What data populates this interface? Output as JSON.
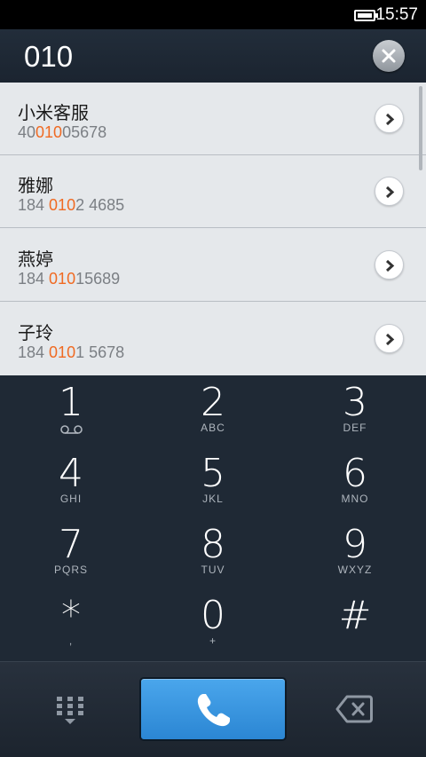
{
  "status_bar": {
    "time": "15:57"
  },
  "dialer": {
    "dialed_number": "010"
  },
  "results": [
    {
      "name": "小米客服",
      "number_pre": "40",
      "number_match": "010",
      "number_post": "05678"
    },
    {
      "name": "雅娜",
      "number_pre": "184 ",
      "number_match": "010",
      "number_post": "2 4685"
    },
    {
      "name": "燕婷",
      "number_pre": "184 ",
      "number_match": "010",
      "number_post": "15689"
    },
    {
      "name": "子玲",
      "number_pre": "184 ",
      "number_match": "010",
      "number_post": "1 5678"
    }
  ],
  "keypad": [
    {
      "digit": "1",
      "letters": "",
      "icon": "voicemail-icon"
    },
    {
      "digit": "2",
      "letters": "ABC"
    },
    {
      "digit": "3",
      "letters": "DEF"
    },
    {
      "digit": "4",
      "letters": "GHI"
    },
    {
      "digit": "5",
      "letters": "JKL"
    },
    {
      "digit": "6",
      "letters": "MNO"
    },
    {
      "digit": "7",
      "letters": "PQRS"
    },
    {
      "digit": "8",
      "letters": "TUV"
    },
    {
      "digit": "9",
      "letters": "WXYZ"
    },
    {
      "digit": "*",
      "letters": ","
    },
    {
      "digit": "0",
      "letters": "+"
    },
    {
      "digit": "#",
      "letters": ""
    }
  ],
  "colors": {
    "highlight": "#f06a22",
    "call_button": "#3596e0",
    "keypad_bg": "#1f2935"
  }
}
